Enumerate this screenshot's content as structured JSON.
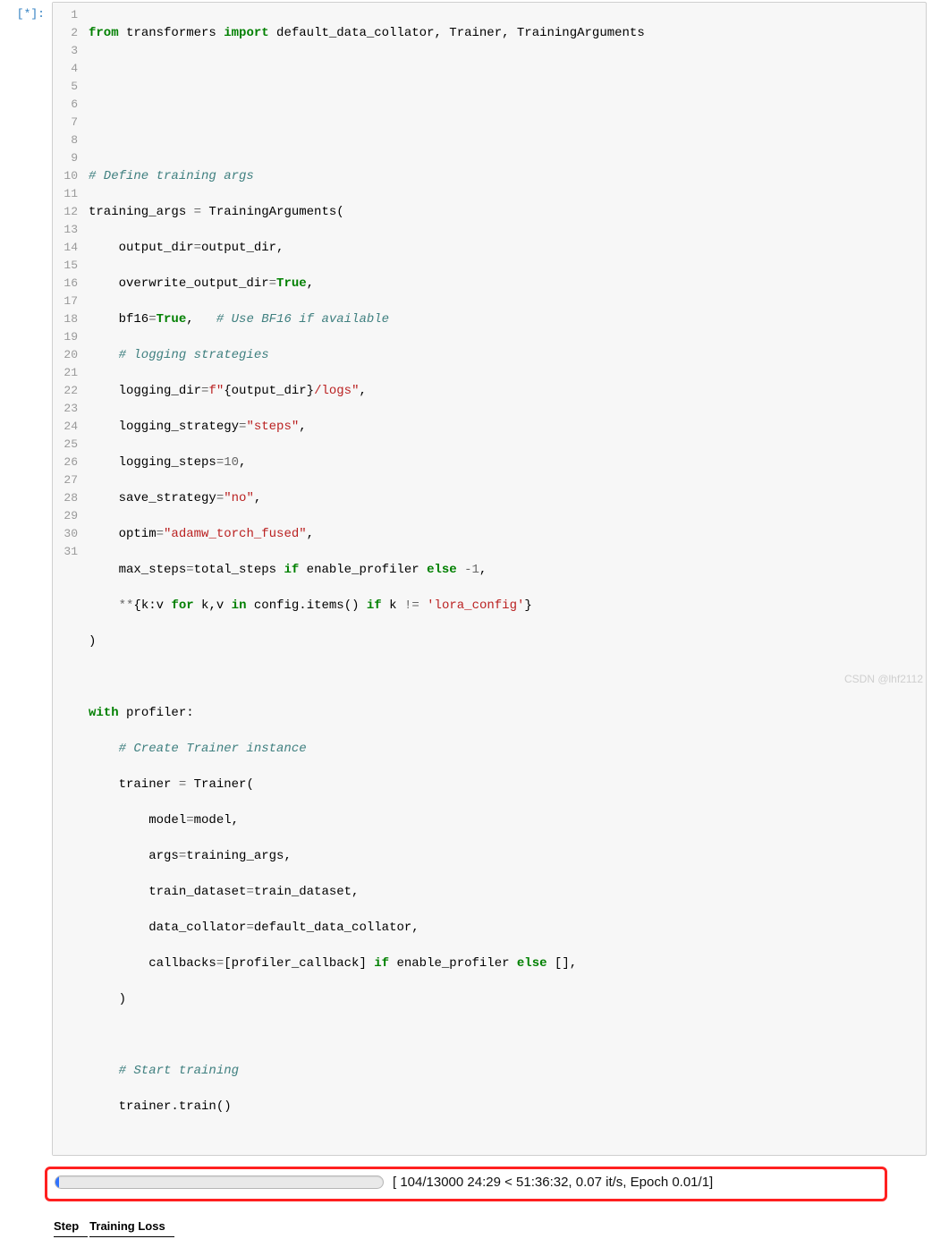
{
  "prompt": "[*]:",
  "progress": {
    "text": "[ 104/13000 24:29 < 51:36:32, 0.07 it/s, Epoch 0.01/1]"
  },
  "table": {
    "headers": [
      "Step",
      "Training Loss"
    ]
  },
  "watermark": "CSDN @lhf2112",
  "gutter": [
    "1",
    "2",
    "3",
    "4",
    "5",
    "6",
    "7",
    "8",
    "9",
    "10",
    "11",
    "12",
    "13",
    "14",
    "15",
    "16",
    "17",
    "18",
    "19",
    "20",
    "21",
    "22",
    "23",
    "24",
    "25",
    "26",
    "27",
    "28",
    "29",
    "30",
    "31"
  ],
  "code": {
    "l1": {
      "a": "from",
      "b": " transformers ",
      "c": "import",
      "d": " default_data_collator, Trainer, TrainingArguments"
    },
    "l5": "# Define training args",
    "l6": {
      "a": "training_args ",
      "b": "=",
      "c": " TrainingArguments("
    },
    "l7": {
      "a": "    output_dir",
      "b": "=",
      "c": "output_dir,"
    },
    "l8": {
      "a": "    overwrite_output_dir",
      "b": "=",
      "c": "True",
      "d": ","
    },
    "l9": {
      "a": "    bf16",
      "b": "=",
      "c": "True",
      "d": ",   ",
      "e": "# Use BF16 if available"
    },
    "l10": "    # logging strategies",
    "l11": {
      "a": "    logging_dir",
      "b": "=",
      "c": "f\"",
      "d": "{output_dir}",
      "e": "/logs\"",
      "f": ","
    },
    "l12": {
      "a": "    logging_strategy",
      "b": "=",
      "c": "\"steps\"",
      "d": ","
    },
    "l13": {
      "a": "    logging_steps",
      "b": "=",
      "c": "10",
      "d": ","
    },
    "l14": {
      "a": "    save_strategy",
      "b": "=",
      "c": "\"no\"",
      "d": ","
    },
    "l15": {
      "a": "    optim",
      "b": "=",
      "c": "\"adamw_torch_fused\"",
      "d": ","
    },
    "l16": {
      "a": "    max_steps",
      "b": "=",
      "c": "total_steps ",
      "d": "if",
      "e": " enable_profiler ",
      "f": "else",
      "g": " ",
      "h": "-",
      "i": "1",
      "j": ","
    },
    "l17": {
      "a": "    ",
      "b": "**",
      "c": "{k:v ",
      "d": "for",
      "e": " k,v ",
      "f": "in",
      "g": " config.items() ",
      "h": "if",
      "i": " k ",
      "j": "!=",
      "k": " ",
      "l": "'lora_config'",
      "m": "}"
    },
    "l18": ")",
    "l20": {
      "a": "with",
      "b": " profiler:"
    },
    "l21": "    # Create Trainer instance",
    "l22": {
      "a": "    trainer ",
      "b": "=",
      "c": " Trainer("
    },
    "l23": {
      "a": "        model",
      "b": "=",
      "c": "model,"
    },
    "l24": {
      "a": "        args",
      "b": "=",
      "c": "training_args,"
    },
    "l25": {
      "a": "        train_dataset",
      "b": "=",
      "c": "train_dataset,"
    },
    "l26": {
      "a": "        data_collator",
      "b": "=",
      "c": "default_data_collator,"
    },
    "l27": {
      "a": "        callbacks",
      "b": "=",
      "c": "[profiler_callback] ",
      "d": "if",
      "e": " enable_profiler ",
      "f": "else",
      "g": " [],"
    },
    "l28": "    )",
    "l30": "    # Start training",
    "l31": "    trainer.train()"
  }
}
